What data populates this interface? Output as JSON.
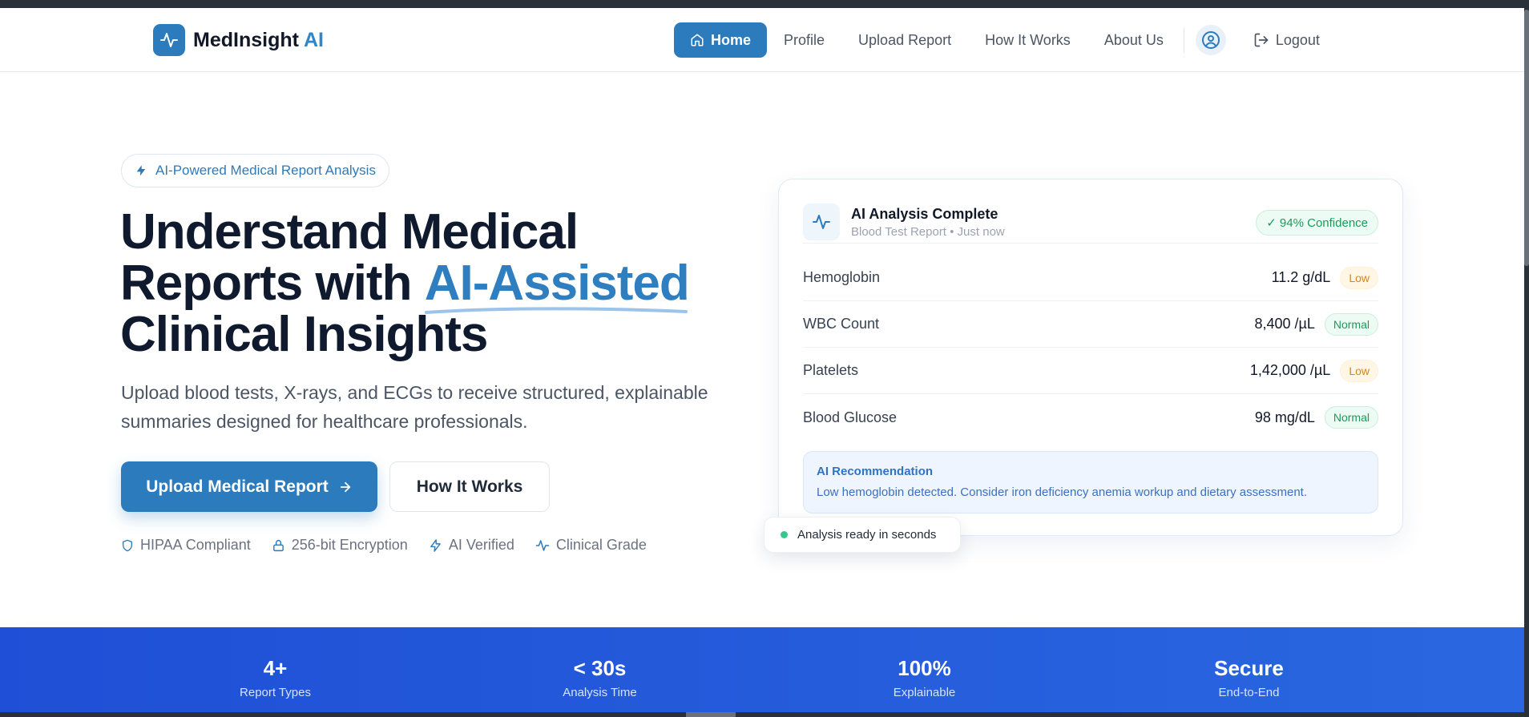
{
  "nav": {
    "logo_text": "MedInsight",
    "logo_accent": "AI",
    "items": [
      {
        "label": "Home",
        "active": true
      },
      {
        "label": "Profile"
      },
      {
        "label": "Upload Report"
      },
      {
        "label": "How It Works"
      },
      {
        "label": "About Us"
      }
    ],
    "logout": "Logout"
  },
  "hero": {
    "badge": "AI-Powered Medical Report Analysis",
    "title_line1": "Understand Medical",
    "title_line2_pre": "Reports with ",
    "title_line2_accent": "AI-Assisted",
    "title_line3": "Clinical Insights",
    "subtitle": "Upload blood tests, X-rays, and ECGs to receive structured, explainable summaries designed for healthcare professionals.",
    "primary_button": "Upload Medical Report",
    "secondary_button": "How It Works",
    "trust": [
      "HIPAA Compliant",
      "256-bit Encryption",
      "AI Verified",
      "Clinical Grade"
    ]
  },
  "card": {
    "title": "AI Analysis Complete",
    "meta": "Blood Test Report • Just now",
    "confidence": "✓ 94% Confidence",
    "rows": [
      {
        "label": "Hemoglobin",
        "value": "11.2 g/dL",
        "status": "Low"
      },
      {
        "label": "WBC Count",
        "value": "8,400 /µL",
        "status": "Normal"
      },
      {
        "label": "Platelets",
        "value": "1,42,000 /µL",
        "status": "Low"
      },
      {
        "label": "Blood Glucose",
        "value": "98 mg/dL",
        "status": "Normal"
      }
    ],
    "recommendation_title": "AI Recommendation",
    "recommendation_text": "Low hemoglobin detected. Consider iron deficiency anemia workup and dietary assessment."
  },
  "floating_pill": "Analysis ready in seconds",
  "stats": [
    {
      "value": "4+",
      "label": "Report Types"
    },
    {
      "value": "< 30s",
      "label": "Analysis Time"
    },
    {
      "value": "100%",
      "label": "Explainable"
    },
    {
      "value": "Secure",
      "label": "End-to-End"
    }
  ],
  "colors": {
    "primary": "#2b7bbd",
    "accent_text": "#2f7fc0",
    "heading": "#101a2e",
    "low_status": "#d6851f",
    "normal_status": "#1c9a5b",
    "stats_bg": "#1f4fd6"
  }
}
